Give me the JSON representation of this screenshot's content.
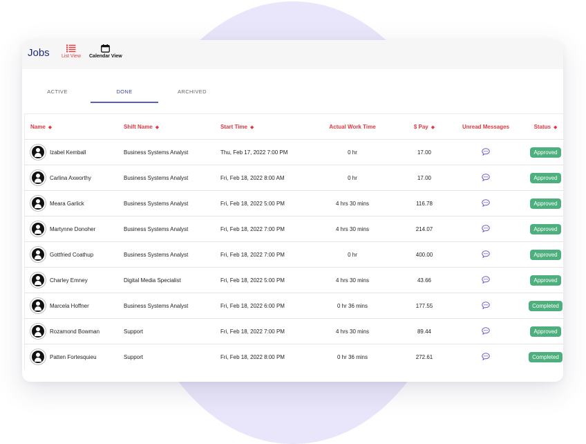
{
  "header": {
    "title": "Jobs",
    "views": [
      {
        "label": "List View",
        "icon": "list-icon"
      },
      {
        "label": "Calendar View",
        "icon": "calendar-icon"
      }
    ]
  },
  "tabs": [
    "ACTIVE",
    "DONE",
    "ARCHIVED"
  ],
  "active_tab": "DONE",
  "colors": {
    "accent": "#e0393e",
    "title": "#1e2a78",
    "tab_active": "#3b45a0",
    "status_green": "#4caf7d",
    "message_icon": "#6a5acd",
    "background_blob": "#e9e6fb"
  },
  "columns": [
    "Name",
    "Shift Name",
    "Start Time",
    "Actual Work Time",
    "$ Pay",
    "Unread Messages",
    "Status"
  ],
  "rows": [
    {
      "name": "Izabel Kemball",
      "shift": "Business Systems Analyst",
      "start": "Thu, Feb 17, 2022 7:00 PM",
      "work": "0 hr",
      "pay": "17.00",
      "status": "Approved"
    },
    {
      "name": "Carlina Axworthy",
      "shift": "Business Systems Analyst",
      "start": "Fri, Feb 18, 2022 8:00 AM",
      "work": "0 hr",
      "pay": "17.00",
      "status": "Approved"
    },
    {
      "name": "Meara Garlick",
      "shift": "Business Systems Analyst",
      "start": "Fri, Feb 18, 2022 5:00 PM",
      "work": "4 hrs 30 mins",
      "pay": "116.78",
      "status": "Approved"
    },
    {
      "name": "Martynne Donoher",
      "shift": "Business Systems Analyst",
      "start": "Fri, Feb 18, 2022 7:00 PM",
      "work": "4 hrs 30 mins",
      "pay": "214.07",
      "status": "Approved"
    },
    {
      "name": "Gottfried Coathup",
      "shift": "Business Systems Analyst",
      "start": "Fri, Feb 18, 2022 7:00 PM",
      "work": "0 hr",
      "pay": "400.00",
      "status": "Approved"
    },
    {
      "name": "Charley Emney",
      "shift": "Digital Media Specialist",
      "start": "Fri, Feb 18, 2022 5:00 PM",
      "work": "4 hrs 30 mins",
      "pay": "43.66",
      "status": "Approved"
    },
    {
      "name": "Marcela Hoffner",
      "shift": "Business Systems Analyst",
      "start": "Fri, Feb 18, 2022 6:00 PM",
      "work": "0 hr 36 mins",
      "pay": "177.55",
      "status": "Completed"
    },
    {
      "name": "Rozamond Bowman",
      "shift": "Support",
      "start": "Fri, Feb 18, 2022 7:00 PM",
      "work": "4 hrs 30 mins",
      "pay": "89.44",
      "status": "Approved"
    },
    {
      "name": "Patten Fortesquieu",
      "shift": "Support",
      "start": "Fri, Feb 18, 2022 8:00 PM",
      "work": "0 hr 36 mins",
      "pay": "272.61",
      "status": "Completed"
    }
  ]
}
